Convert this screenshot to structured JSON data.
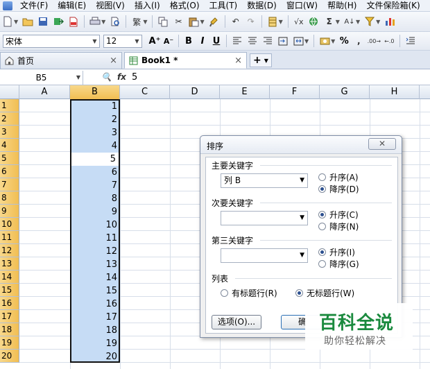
{
  "menu": [
    "文件(F)",
    "编辑(E)",
    "视图(V)",
    "插入(I)",
    "格式(O)",
    "工具(T)",
    "数据(D)",
    "窗口(W)",
    "帮助(H)",
    "文件保险箱(K)"
  ],
  "format_bar": {
    "font_name": "宋体",
    "font_size": "12",
    "bold": "B",
    "italic": "I",
    "underline": "U",
    "grow_font": "A⁺",
    "shrink_font": "A⁻",
    "percent": "%"
  },
  "tabs": [
    {
      "label": "首页",
      "close": "×"
    },
    {
      "label": "Book1 *",
      "close": "×"
    }
  ],
  "tab_add": "+",
  "formula_bar": {
    "cell_ref": "B5",
    "fx": "fx",
    "value": "5"
  },
  "columns": [
    "A",
    "B",
    "C",
    "D",
    "E",
    "F",
    "G",
    "H"
  ],
  "rows": [
    "1",
    "2",
    "3",
    "4",
    "5",
    "6",
    "7",
    "8",
    "9",
    "10",
    "11",
    "12",
    "13",
    "14",
    "15",
    "16",
    "17",
    "18",
    "19",
    "20"
  ],
  "column_b_values": [
    "1",
    "2",
    "3",
    "4",
    "5",
    "6",
    "7",
    "8",
    "9",
    "10",
    "11",
    "12",
    "13",
    "14",
    "15",
    "16",
    "17",
    "18",
    "19",
    "20"
  ],
  "dialog": {
    "title": "排序",
    "close": "✕",
    "primary_key": {
      "label": "主要关键字",
      "value": "列 B",
      "asc": "升序(A)",
      "desc": "降序(D)"
    },
    "secondary_key": {
      "label": "次要关键字",
      "value": "",
      "asc": "升序(C)",
      "desc": "降序(N)"
    },
    "third_key": {
      "label": "第三关键字",
      "value": "",
      "asc": "升序(I)",
      "desc": "降序(G)"
    },
    "list": {
      "label": "列表",
      "header_row": "有标题行(R)",
      "no_header_row": "无标题行(W)"
    },
    "options_button": "选项(O)...",
    "ok_button": "确"
  },
  "watermark": {
    "title": "百科全说",
    "subtitle": "助你轻松解决"
  }
}
